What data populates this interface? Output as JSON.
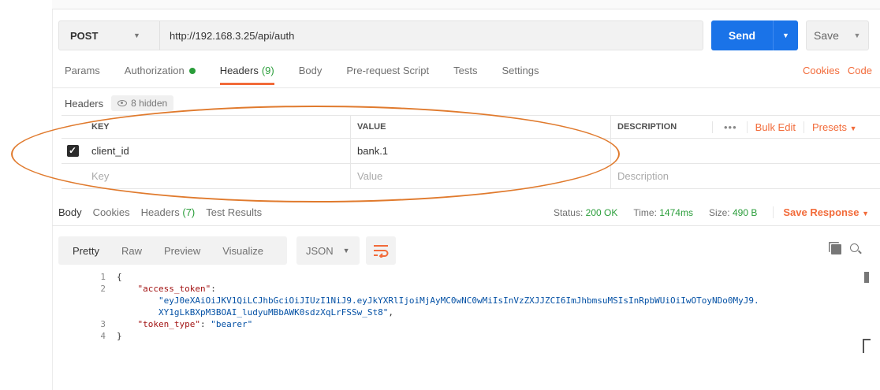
{
  "request": {
    "method": "POST",
    "url": "http://192.168.3.25/api/auth",
    "send_label": "Send",
    "save_label": "Save"
  },
  "request_tabs": [
    {
      "label": "Params"
    },
    {
      "label": "Authorization"
    },
    {
      "label": "Headers",
      "count": "(9)"
    },
    {
      "label": "Body"
    },
    {
      "label": "Pre-request Script"
    },
    {
      "label": "Tests"
    },
    {
      "label": "Settings"
    }
  ],
  "request_links": {
    "cookies": "Cookies",
    "code": "Code"
  },
  "headers_section": {
    "title": "Headers",
    "hidden": "8 hidden"
  },
  "table": {
    "columns": {
      "key": "KEY",
      "value": "VALUE",
      "description": "DESCRIPTION"
    },
    "actions": {
      "dots": "•••",
      "bulk_edit": "Bulk Edit",
      "presets": "Presets"
    },
    "rows": [
      {
        "checked": true,
        "key": "client_id",
        "value": "bank.1",
        "description": ""
      }
    ],
    "placeholders": {
      "key": "Key",
      "value": "Value",
      "description": "Description"
    }
  },
  "response_tabs": {
    "body": "Body",
    "cookies": "Cookies",
    "headers": "Headers",
    "headers_count": "(7)",
    "test_results": "Test Results"
  },
  "response_status": {
    "status_label": "Status:",
    "status_value": "200 OK",
    "time_label": "Time:",
    "time_value": "1474ms",
    "size_label": "Size:",
    "size_value": "490 B",
    "save_response": "Save Response"
  },
  "body_toolbar": {
    "pretty": "Pretty",
    "raw": "Raw",
    "preview": "Preview",
    "visualize": "Visualize",
    "format": "JSON"
  },
  "code_lines": {
    "l1": "{",
    "l2_key": "\"access_token\"",
    "l2_value_a": "\"eyJ0eXAiOiJKV1QiLCJhbGciOiJIUzI1NiJ9.eyJkYXRlIjoiMjAyMC0wNC0wMiIsInVzZXJJZCI6ImJhbmsuMSIsInRpbWUiOiIwOToyNDo0MyJ9.",
    "l2_value_b": "XY1gLkBXpM3BOAI_ludyuMBbAWK0sdzXqLrFSSw_St8\"",
    "l3_key": "\"token_type\"",
    "l3_value": "\"bearer\"",
    "l4": "}"
  },
  "line_numbers": [
    "1",
    "2",
    "3",
    "4"
  ],
  "colors": {
    "accent": "#f26b3a",
    "send": "#1a73e8",
    "ok": "#2a9d3a",
    "annotation": "#e07a2d"
  }
}
